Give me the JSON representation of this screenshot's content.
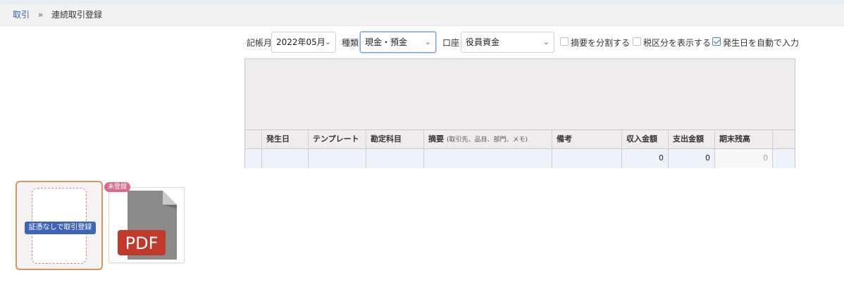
{
  "breadcrumb": {
    "root": "取引",
    "separator": "»",
    "current": "連続取引登録"
  },
  "filters": {
    "month_label": "記帳月",
    "month_value": "2022年05月",
    "type_label": "種類",
    "type_value": "現金・預金",
    "account_label": "口座",
    "account_value": "役員資金",
    "split_summary": {
      "label": "摘要を分割する",
      "checked": false
    },
    "tax_category": {
      "label": "税区分を表示する",
      "checked": false
    },
    "auto_date": {
      "label": "発生日を自動で入力",
      "checked": true
    }
  },
  "table": {
    "headers": {
      "date": "発生日",
      "template": "テンプレート",
      "account": "勘定科目",
      "summary": "摘要",
      "summary_sub": "(取引先、品目、部門、メモ)",
      "note": "備考",
      "income": "収入金額",
      "expense": "支出金額",
      "balance": "期末残高"
    },
    "row": {
      "income": "0",
      "expense": "0",
      "balance": "0"
    }
  },
  "evidence": {
    "no_evidence_button": "証憑なしで取引登録",
    "pdf_badge": "未登録",
    "pdf_label": "PDF"
  },
  "colors": {
    "link": "#2f62b3",
    "accent_border": "#d99558",
    "button": "#3f64b7",
    "badge": "#d9698f",
    "pdf_red": "#c0392b"
  }
}
